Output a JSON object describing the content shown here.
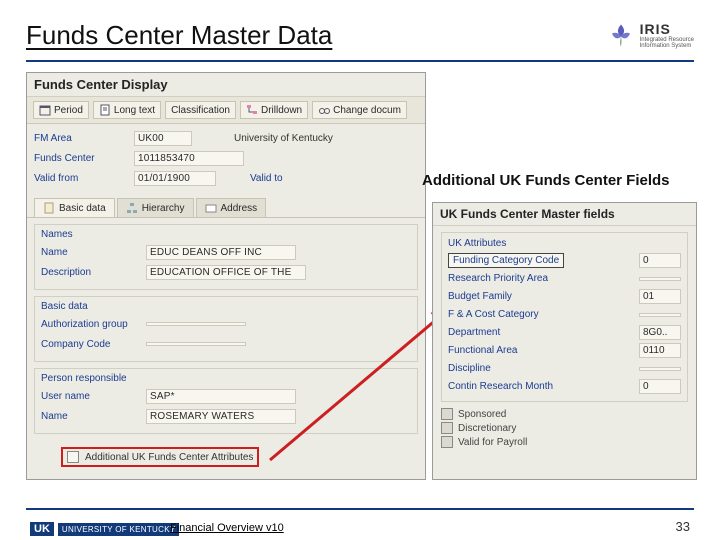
{
  "slide": {
    "title": "Funds Center Master Data",
    "footer_text": "Financial Overview v10",
    "page": "33"
  },
  "iris_logo": {
    "label": "IRIS",
    "sub1": "Integrated Resource",
    "sub2": "Information System"
  },
  "sap": {
    "title": "Funds Center Display",
    "toolbar": [
      "Period",
      "Long text",
      "Classification",
      "Drilldown",
      "Change docum"
    ],
    "fm_area_label": "FM Area",
    "fm_area": "UK00",
    "fm_area_desc": "University of Kentucky",
    "funds_center_label": "Funds Center",
    "funds_center": "1011853470",
    "valid_from_label": "Valid from",
    "valid_from": "01/01/1900",
    "valid_to_label": "Valid to",
    "tabs": [
      "Basic data",
      "Hierarchy",
      "Address"
    ],
    "names_title": "Names",
    "name_label": "Name",
    "name": "EDUC DEANS OFF INC",
    "desc_label": "Description",
    "desc": "EDUCATION OFFICE OF THE",
    "basic_title": "Basic data",
    "auth_label": "Authorization group",
    "auth": "",
    "company_label": "Company Code",
    "company": "",
    "person_title": "Person responsible",
    "user_label": "User name",
    "user": "SAP*",
    "pname_label": "Name",
    "pname": "ROSEMARY WATERS",
    "attr_label": "Additional UK Funds Center Attributes"
  },
  "callout_label": "Additional UK Funds Center Fields",
  "sap2": {
    "title": "UK Funds Center Master fields",
    "panel_title": "UK Attributes",
    "rows": [
      {
        "label": "Funding Category Code",
        "value": "0"
      },
      {
        "label": "Research Priority Area",
        "value": ""
      },
      {
        "label": "Budget Family",
        "value": "01"
      },
      {
        "label": "F & A Cost Category",
        "value": ""
      },
      {
        "label": "Department",
        "value": "8G0.."
      },
      {
        "label": "Functional Area",
        "value": "0110"
      },
      {
        "label": "Discipline",
        "value": ""
      },
      {
        "label": "Contin Research Month",
        "value": "0"
      }
    ],
    "flags": [
      "Sponsored",
      "Discretionary",
      "Valid for Payroll"
    ]
  },
  "uk_logo": {
    "initials": "UK",
    "name": "UNIVERSITY OF KENTUCKY"
  }
}
